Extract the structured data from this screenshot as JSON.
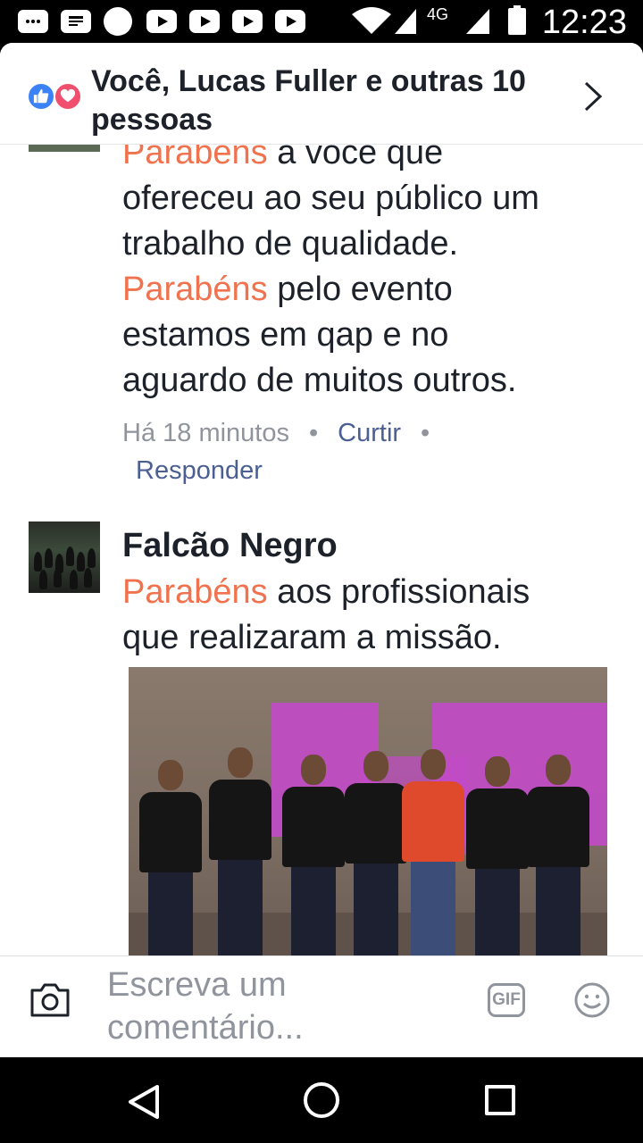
{
  "status_bar": {
    "network": "4G",
    "time": "12:23"
  },
  "header": {
    "title": "Você, Lucas Fuller e outras 10 pessoas",
    "reactions": [
      "like-icon",
      "love-icon"
    ],
    "colors": {
      "like": "#3b82f6",
      "love": "#f0506e"
    }
  },
  "comment1": {
    "line0_hl": "Parabens",
    "line0_rest": " a voce que",
    "line1": "ofereceu  ao seu público um",
    "line2": "trabalho de qualidade.",
    "line3_hl": "Parabéns",
    "line3_rest": " pelo evento",
    "line4": "estamos  em qap e no",
    "line5": "aguardo de muitos outros.",
    "time": "Há 18 minutos",
    "like_label": "Curtir",
    "reply_label": "Responder"
  },
  "comment2": {
    "author": "Falcão Negro",
    "line0_hl": "Parabéns",
    "line0_rest": " aos profissionais",
    "line1": "que realizaram a missão."
  },
  "composer": {
    "placeholder": "Escreva um comentário...",
    "gif_label": "GIF",
    "icons": [
      "camera-icon",
      "gif-icon",
      "emoji-icon"
    ]
  },
  "colors": {
    "highlight": "#f0724e",
    "link": "#4b5f93",
    "meta": "#90949c"
  }
}
